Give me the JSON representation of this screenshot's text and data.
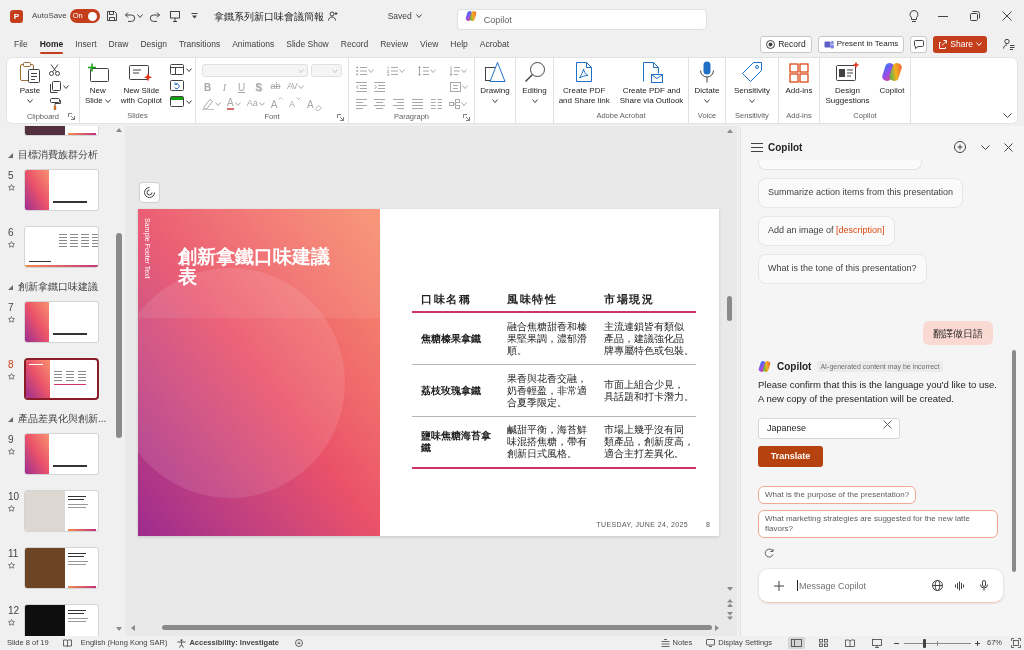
{
  "title_bar": {
    "app_icon_letter": "P",
    "autosave": {
      "label": "AutoSave",
      "on": true,
      "state_text": "On"
    },
    "document_title": "拿鐵系列新口味會議簡報",
    "save_status": "Saved",
    "search": {
      "placeholder": "Copilot"
    }
  },
  "ribbon_tabs": [
    {
      "label": "File",
      "selected": false
    },
    {
      "label": "Home",
      "selected": true
    },
    {
      "label": "Insert",
      "selected": false
    },
    {
      "label": "Draw",
      "selected": false
    },
    {
      "label": "Design",
      "selected": false
    },
    {
      "label": "Transitions",
      "selected": false
    },
    {
      "label": "Animations",
      "selected": false
    },
    {
      "label": "Slide Show",
      "selected": false
    },
    {
      "label": "Record",
      "selected": false
    },
    {
      "label": "Review",
      "selected": false
    },
    {
      "label": "View",
      "selected": false
    },
    {
      "label": "Help",
      "selected": false
    },
    {
      "label": "Acrobat",
      "selected": false
    }
  ],
  "tab_bar_actions": [
    {
      "kind": "record",
      "label": "Record"
    },
    {
      "kind": "teams",
      "label": "Present in Teams"
    },
    {
      "kind": "comments"
    },
    {
      "kind": "share",
      "label": "Share"
    },
    {
      "kind": "catch-up"
    }
  ],
  "ribbon": {
    "groups": [
      {
        "kind": "clipboard",
        "label": "Clipboard",
        "disabled": false,
        "launcher": true,
        "buttons": [
          {
            "kind": "paste",
            "label": "Paste",
            "dropdown": true
          }
        ]
      },
      {
        "kind": "slides",
        "label": "Slides",
        "disabled": false,
        "launcher": false,
        "buttons": [
          {
            "kind": "new-slide",
            "label": "New\nSlide",
            "dropdown": true
          },
          {
            "kind": "new-slide-copilot",
            "label": "New Slide\nwith Copilot",
            "dropdown": false
          }
        ]
      },
      {
        "kind": "font",
        "label": "Font",
        "disabled": true,
        "launcher": true,
        "format_rows": [
          [
            {
              "kind": "bold",
              "text": "B",
              "dropdown": false
            },
            {
              "kind": "italic",
              "text": "I",
              "dropdown": false
            },
            {
              "kind": "underline",
              "text": "U",
              "dropdown": false
            },
            {
              "kind": "shadow",
              "text": "S",
              "dropdown": false
            },
            {
              "kind": "strike",
              "text": "ab",
              "dropdown": false
            },
            {
              "kind": "spacing",
              "text": "AV",
              "dropdown": true
            }
          ],
          [
            {
              "kind": "highlight",
              "dropdown": true
            },
            {
              "kind": "font-color",
              "text": "A",
              "dropdown": true
            },
            {
              "kind": "case",
              "text": "Aa",
              "dropdown": true
            },
            {
              "kind": "grow",
              "text": "A",
              "dropdown": false
            },
            {
              "kind": "shrink",
              "text": "A",
              "dropdown": false
            },
            {
              "kind": "clear",
              "text": "A",
              "dropdown": false
            }
          ]
        ]
      },
      {
        "kind": "paragraph",
        "label": "Paragraph",
        "disabled": true,
        "launcher": true
      },
      {
        "kind": "drawing",
        "disabled": false,
        "launcher": false,
        "buttons": [
          {
            "kind": "drawing",
            "label": "Drawing",
            "dropdown": true
          }
        ]
      },
      {
        "kind": "editing",
        "disabled": false,
        "launcher": false,
        "buttons": [
          {
            "kind": "editing",
            "label": "Editing",
            "dropdown": true
          }
        ]
      },
      {
        "kind": "acrobat",
        "label": "Adobe Acrobat",
        "disabled": false,
        "launcher": false,
        "buttons": [
          {
            "kind": "pdf-link",
            "label": "Create PDF\nand Share link",
            "dropdown": false
          },
          {
            "kind": "pdf-outlook",
            "label": "Create PDF and\nShare via Outlook",
            "dropdown": false
          }
        ]
      },
      {
        "kind": "voice",
        "label": "Voice",
        "disabled": false,
        "launcher": false,
        "buttons": [
          {
            "kind": "dictate",
            "label": "Dictate",
            "dropdown": true
          }
        ]
      },
      {
        "kind": "sensitivity",
        "label": "Sensitivity",
        "disabled": false,
        "launcher": false,
        "buttons": [
          {
            "kind": "sensitivity",
            "label": "Sensitivity",
            "dropdown": true
          }
        ]
      },
      {
        "kind": "addins",
        "label": "Add-ins",
        "disabled": false,
        "launcher": false,
        "buttons": [
          {
            "kind": "add-ins",
            "label": "Add-ins",
            "dropdown": false
          }
        ]
      },
      {
        "kind": "copilot",
        "label": "Copilot",
        "disabled": false,
        "launcher": false,
        "buttons": [
          {
            "kind": "design",
            "label": "Design\nSuggestions",
            "dropdown": false
          },
          {
            "kind": "copilot",
            "label": "Copilot",
            "dropdown": false
          }
        ]
      }
    ]
  },
  "slide_panel": {
    "sections": [
      {
        "slides": [
          {
            "kind": "photo-dark",
            "selected": false
          }
        ]
      },
      {
        "title": "目標消費族群分析",
        "expanded": true,
        "slides": [
          {
            "number": "5",
            "kind": "title",
            "selected": false
          },
          {
            "number": "6",
            "kind": "table",
            "selected": false
          }
        ]
      },
      {
        "title": "創新拿鐵口味建議",
        "expanded": true,
        "slides": [
          {
            "number": "7",
            "kind": "title",
            "selected": false
          },
          {
            "number": "8",
            "kind": "title-table",
            "selected": true
          }
        ]
      },
      {
        "title": "產品差異化與創新...",
        "expanded": true,
        "slides": [
          {
            "number": "9",
            "kind": "title",
            "selected": false
          },
          {
            "number": "10",
            "kind": "photo-light",
            "selected": false
          },
          {
            "number": "11",
            "kind": "photo-brown",
            "selected": false
          },
          {
            "number": "12",
            "kind": "photo-black",
            "selected": false
          }
        ]
      }
    ]
  },
  "slide": {
    "footer": "Sample Footer Text",
    "title": "創新拿鐵口味建議表",
    "table": {
      "columns": [
        "口味名稱",
        "風味特性",
        "市場現況"
      ],
      "rows": [
        [
          "焦糖榛果拿鐵",
          "融合焦糖甜香和榛果堅果調，濃郁滑順。",
          "主流連鎖皆有類似產品，建議強化品牌專屬特色或包裝。"
        ],
        [
          "荔枝玫瑰拿鐵",
          "果香與花香交融，奶香輕盈，非常適合夏季限定。",
          "市面上組合少見，具話題和打卡潛力。"
        ],
        [
          "鹽味焦糖海苔拿鐵",
          "鹹甜平衡，海苔鮮味混搭焦糖，帶有創新日式風格。",
          "市場上幾乎沒有同類產品，創新度高，適合主打差異化。"
        ]
      ]
    },
    "date": "TUESDAY, JUNE 24, 2025",
    "page_number": "8"
  },
  "copilot_pane": {
    "title": "Copilot",
    "messages": [
      {
        "kind": "prompt-chip",
        "cut_off": true
      },
      {
        "kind": "prompt-chip",
        "cut_off": false,
        "parts": [
          {
            "kind": "plain",
            "text": "Summarize action items from this presentation"
          }
        ]
      },
      {
        "kind": "prompt-chip",
        "cut_off": false,
        "parts": [
          {
            "kind": "plain",
            "text": "Add an image of "
          },
          {
            "kind": "variable",
            "text": "[description]"
          }
        ]
      },
      {
        "kind": "prompt-chip",
        "cut_off": false,
        "parts": [
          {
            "kind": "plain",
            "text": "What is the tone of this presentation?"
          }
        ]
      },
      {
        "kind": "user",
        "text": "翻譯做日語"
      },
      {
        "kind": "assistant",
        "sender": "Copilot",
        "disclaimer": "AI-generated content may be incorrect",
        "text": "Please confirm that this is the language you'd like to use. A new copy of the presentation will be created.",
        "language_field": {
          "value": "Japanese"
        },
        "action": "Translate"
      },
      {
        "kind": "suggestions",
        "items": [
          "What is the purpose of the presentation?",
          "What marketing strategies are suggested for the new latte flavors?"
        ]
      }
    ],
    "composer": {
      "placeholder": "Message Copilot",
      "focused": true
    }
  },
  "status_bar": {
    "slide_position": "Slide 8 of 19",
    "language": "English (Hong Kong SAR)",
    "accessibility": "Accessibility: Investigate",
    "notes": "Notes",
    "display_settings": "Display Settings",
    "views": [
      {
        "kind": "normal",
        "selected": true
      },
      {
        "kind": "sorter",
        "selected": false
      },
      {
        "kind": "reading",
        "selected": false
      },
      {
        "kind": "slideshow",
        "selected": false
      }
    ],
    "zoom": {
      "level": 0.31,
      "reading": "67%"
    }
  }
}
